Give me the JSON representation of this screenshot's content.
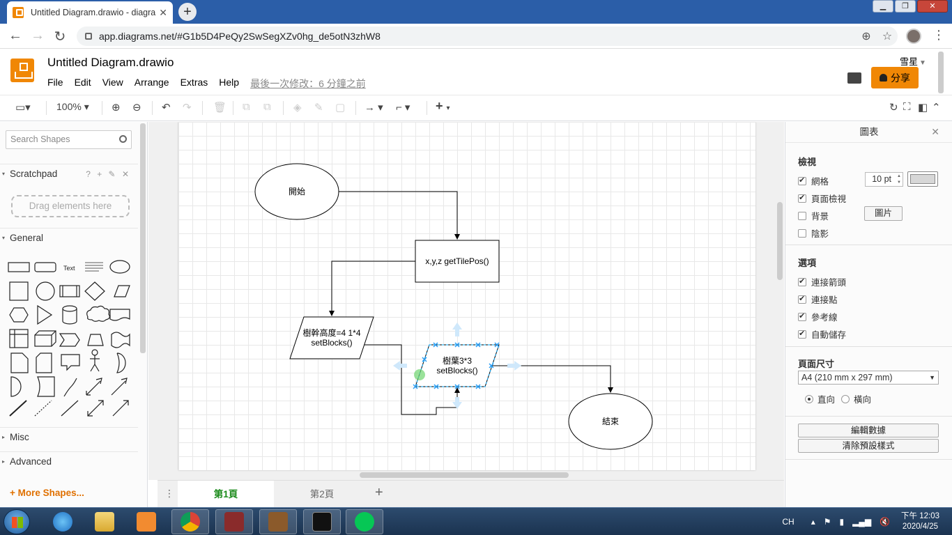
{
  "browser": {
    "tab_title": "Untitled Diagram.drawio - diagra",
    "url": "app.diagrams.net/#G1b5D4PeQy2SwSegXZv0hg_de5otN3zhW8",
    "win_minimize": "▁",
    "win_restore": "❐",
    "win_close": "✕"
  },
  "app": {
    "doc_title": "Untitled Diagram.drawio",
    "menus": [
      "File",
      "Edit",
      "View",
      "Arrange",
      "Extras",
      "Help"
    ],
    "last_modified": "最後一次修改：6 分鐘之前",
    "user_name": "雪星",
    "share_label": "分享",
    "brand_color": "#f08705"
  },
  "toolbar": {
    "zoom": "100%"
  },
  "sidebar": {
    "search_placeholder": "Search Shapes",
    "scratchpad_label": "Scratchpad",
    "scratchpad_tools": "? + ✎ ✕",
    "drop_hint": "Drag elements here",
    "general_label": "General",
    "misc_label": "Misc",
    "advanced_label": "Advanced",
    "more_shapes": "More Shapes...",
    "text_shape_label": "Text"
  },
  "diagram": {
    "start_label": "開始",
    "getpos_label": "x,y,z getTilePos()",
    "trunk_line1": "樹幹高度=4 1*4",
    "trunk_line2": "setBlocks()",
    "leaves_line1": "樹葉3*3",
    "leaves_line2": "setBlocks()",
    "end_label": "結束"
  },
  "pages": [
    {
      "label": "第1頁",
      "active": true
    },
    {
      "label": "第2頁",
      "active": false
    }
  ],
  "format_panel": {
    "title": "圖表",
    "view_section": "檢視",
    "grid_label": "網格",
    "grid_checked": true,
    "grid_size": "10 pt",
    "page_view_label": "頁面檢視",
    "page_view_checked": true,
    "background_label": "背景",
    "background_checked": false,
    "image_button": "圖片",
    "shadow_label": "陰影",
    "shadow_checked": false,
    "options_section": "選項",
    "conn_arrows_label": "連接箭頭",
    "conn_points_label": "連接點",
    "guides_label": "參考線",
    "autosave_label": "自動儲存",
    "page_size_section": "頁面尺寸",
    "page_size_value": "A4 (210 mm x 297 mm)",
    "portrait_label": "直向",
    "landscape_label": "橫向",
    "edit_data_button": "編輯數據",
    "clear_style_button": "清除預設樣式"
  },
  "taskbar": {
    "ime": "CH",
    "time": "下午 12:03",
    "date": "2020/4/25"
  }
}
